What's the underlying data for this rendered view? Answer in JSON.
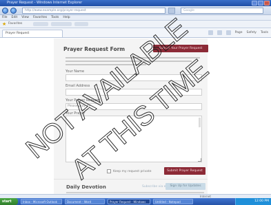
{
  "window": {
    "title": "Prayer Request - Windows Internet Explorer"
  },
  "address_bar": {
    "url": "http://www.example.org/prayer-request",
    "search_placeholder": "Google"
  },
  "menu": {
    "items": [
      "File",
      "Edit",
      "View",
      "Favorites",
      "Tools",
      "Help"
    ]
  },
  "favorites": {
    "label": "Favorites"
  },
  "tab": {
    "label": "Prayer Request"
  },
  "command_bar": {
    "items": [
      "Page",
      "Safety",
      "Tools"
    ]
  },
  "form": {
    "title": "Prayer Request Form",
    "top_action_label": "Submit Your Prayer Request",
    "fields": [
      {
        "label": "Your Name"
      },
      {
        "label": "Email Address"
      },
      {
        "label": "Your Prayer Request",
        "value": "Please pray for"
      },
      {
        "label": "Your Prayer"
      }
    ],
    "privacy_label": "Keep my request private",
    "submit_label": "Submit Prayer Request"
  },
  "section": {
    "title": "Daily Devotion",
    "link_label": "Subscribe via email",
    "subscribe_label": "Sign Up for Updates"
  },
  "status_bar": {
    "text": "Internet"
  },
  "taskbar": {
    "start_label": "start",
    "items": [
      "Inbox - Microsoft Outlook",
      "Document - Word",
      "Prayer Request - Windows",
      "Untitled - Notepad"
    ],
    "clock": "12:00 PM"
  },
  "overlay": {
    "line1": "NOT AVAILABLE",
    "line2": "AT THIS TIME"
  }
}
